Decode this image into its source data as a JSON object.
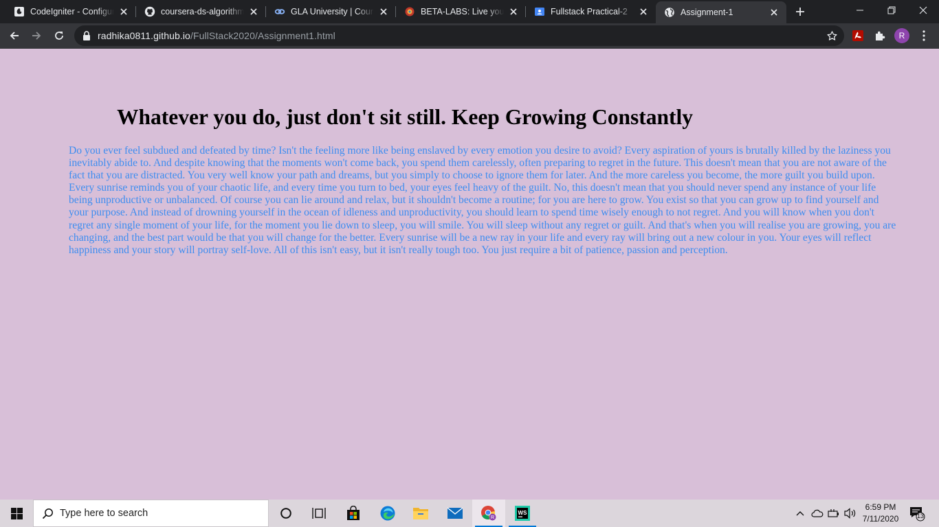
{
  "tabs": [
    {
      "title": "CodeIgniter - Configura",
      "icon": "codeigniter-icon"
    },
    {
      "title": "coursera-ds-algorithms",
      "icon": "github-icon"
    },
    {
      "title": "GLA University | Course",
      "icon": "link-icon"
    },
    {
      "title": "BETA-LABS: Live your W",
      "icon": "beta-labs-icon"
    },
    {
      "title": "Fullstack Practical-2",
      "icon": "google-classroom-icon"
    },
    {
      "title": "Assignment-1",
      "icon": "globe-icon",
      "active": true
    }
  ],
  "address_bar": {
    "host": "radhika0811.github.io",
    "path": "/FullStack2020/Assignment1.html"
  },
  "profile_initial": "R",
  "page": {
    "heading": "Whatever you do, just don't sit still. Keep Growing Constantly",
    "paragraph": "Do you ever feel subdued and defeated by time? Isn't the feeling more like being enslaved by every emotion you desire to avoid? Every aspiration of yours is brutally killed by the laziness you inevitably abide to. And despite knowing that the moments won't come back, you spend them carelessly, often preparing to regret in the future. This doesn't mean that you are not aware of the fact that you are distracted. You very well know your path and dreams, but you simply to choose to ignore them for later. And the more careless you become, the more guilt you build upon. Every sunrise reminds you of your chaotic life, and every time you turn to bed, your eyes feel heavy of the guilt. No, this doesn't mean that you should never spend any instance of your life being unproductive or unbalanced. Of course you can lie around and relax, but it shouldn't become a routine; for you are here to grow. You exist so that you can grow up to find yourself and your purpose. And instead of drowning yourself in the ocean of idleness and unproductivity, you should learn to spend time wisely enough to not regret. And you will know when you don't regret any single moment of your life, for the moment you lie down to sleep, you will smile. You will sleep without any regret or guilt. And that's when you will realise you are growing, you are changing, and the best part would be that you will change for the better. Every sunrise will be a new ray in your life and every ray will bring out a new colour in you. Your eyes will reflect happiness and your story will portray self-love. All of this isn't easy, but it isn't really tough too. You just require a bit of patience, passion and perception."
  },
  "colors": {
    "page_background": "#d8bfd8",
    "paragraph_text": "#3d8df0",
    "heading_text": "#000000"
  },
  "taskbar": {
    "search_placeholder": "Type here to search",
    "time": "6:59 PM",
    "date": "7/11/2020",
    "notification_count": "13"
  }
}
